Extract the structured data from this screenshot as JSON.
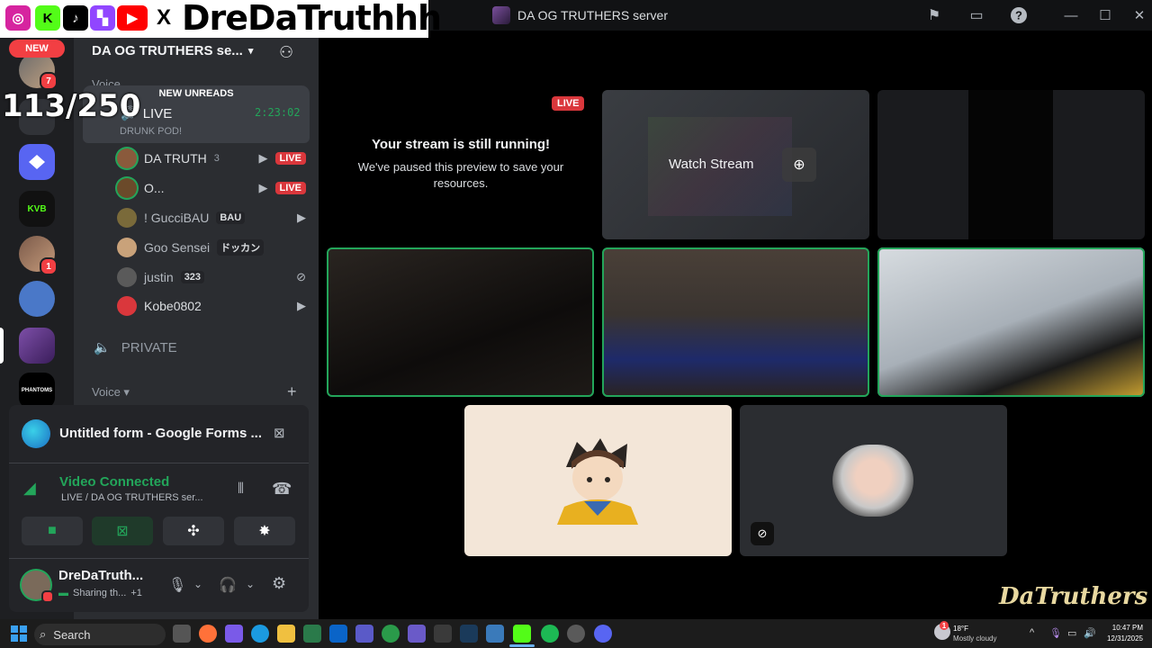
{
  "overlay": {
    "streamer_name": "DreDaTruthhh",
    "counter": "113/250",
    "new_badge": "NEW",
    "socials": [
      {
        "name": "instagram",
        "glyph": "◎",
        "color": "#d6249f"
      },
      {
        "name": "kick",
        "glyph": "K",
        "color": "#53fc18"
      },
      {
        "name": "tiktok",
        "glyph": "♪",
        "color": "#000000"
      },
      {
        "name": "twitch",
        "glyph": "▚",
        "color": "#9146ff"
      },
      {
        "name": "youtube",
        "glyph": "▶",
        "color": "#ff0000"
      },
      {
        "name": "x",
        "glyph": "X",
        "color": "#000000"
      }
    ]
  },
  "titlebar": {
    "server_title": "DA OG TRUTHERS server"
  },
  "rail": {
    "badges": [
      "7",
      "1"
    ],
    "kvb_label": "KVB",
    "phantoms_label": "PHANTOMS"
  },
  "sidebar": {
    "server_name": "DA OG TRUTHERS se...",
    "new_unreads": "NEW UNREADS",
    "voice_category_top": "Voice",
    "live_channel": {
      "name": "LIVE",
      "duration": "2:23:02",
      "status": "DRUNK POD!"
    },
    "users": [
      {
        "name": "DA TRUTH",
        "extra": "3",
        "tag": "LIVE",
        "color": "#8a5a3c"
      },
      {
        "name": "O...",
        "extra": "",
        "tag": "LIVE",
        "color": "#6b4a2a"
      },
      {
        "name": "! GucciBAU",
        "extra": "BAU",
        "tag": "",
        "color": "#7a6a3a"
      },
      {
        "name": "Goo Sensei",
        "extra": "ドッカン",
        "tag": "",
        "color": "#c9a27a"
      },
      {
        "name": "justin",
        "extra": "323",
        "tag": "",
        "color": "#5a5a5a"
      },
      {
        "name": "Kobe0802",
        "extra": "",
        "tag": "",
        "color": "#da373c"
      }
    ],
    "private_channel": "PRIVATE",
    "voice_category": "Voice"
  },
  "panel": {
    "activity_title": "Untitled form - Google Forms ...",
    "voice_status": "Video Connected",
    "voice_channel": "LIVE / DA OG TRUTHERS ser...",
    "username": "DreDaTruth...",
    "user_status": "Sharing th...",
    "user_status_extra": "+1"
  },
  "main": {
    "live_badge": "LIVE",
    "paused_title": "Your stream is still running!",
    "paused_body": "We've paused this preview to save your resources.",
    "watch_stream": "Watch Stream"
  },
  "taskbar": {
    "search_placeholder": "Search",
    "weather_temp": "18°F",
    "weather_desc": "Mostly cloudy",
    "time": "10:47 PM",
    "date": "12/31/2025",
    "weather_badge": "1"
  },
  "watermark": "DaTruthers",
  "colors": {
    "accent_green": "#23a55a",
    "live_red": "#da373c",
    "blurple": "#5865f2"
  }
}
